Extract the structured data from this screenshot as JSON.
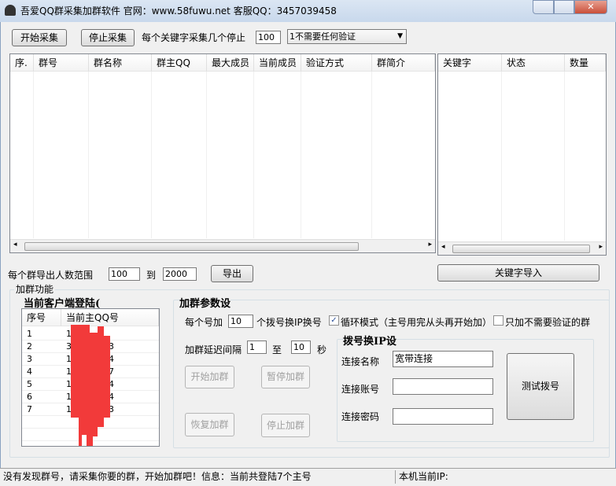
{
  "window": {
    "title": "吾爱QQ群采集加群软件  官网：www.58fuwu.net 客服QQ：3457039458",
    "close_glyph": "✕"
  },
  "toolbar": {
    "start_collect": "开始采集",
    "stop_collect": "停止采集",
    "per_keyword_label": "每个关键字采集几个停止",
    "per_keyword_value": "100",
    "verify_select": "1不需要任何验证",
    "dropdown_glyph": "▼"
  },
  "group_table": {
    "columns": [
      "序.",
      "群号",
      "群名称",
      "群主QQ",
      "最大成员",
      "当前成员",
      "验证方式",
      "群简介"
    ]
  },
  "keyword_table": {
    "columns": [
      "关键字",
      "状态",
      "数量"
    ]
  },
  "scroll": {
    "left": "◂",
    "right": "▸"
  },
  "export": {
    "label": "每个群导出人数范围",
    "min": "100",
    "to": "到",
    "max": "2000",
    "export_button": "导出",
    "keyword_import": "关键字导入"
  },
  "add_group": {
    "title": "加群功能",
    "clients_title": "当前客户端登陆(",
    "clients_columns": [
      "序号",
      "当前主QQ号"
    ],
    "clients": [
      {
        "no": "1",
        "qq_start": "1",
        "qq_end": ""
      },
      {
        "no": "2",
        "qq_start": "3",
        "qq_end": "3"
      },
      {
        "no": "3",
        "qq_start": "1",
        "qq_end": "4"
      },
      {
        "no": "4",
        "qq_start": "1",
        "qq_end": "7"
      },
      {
        "no": "5",
        "qq_start": "1",
        "qq_end": "4"
      },
      {
        "no": "6",
        "qq_start": "1",
        "qq_end": "4"
      },
      {
        "no": "7",
        "qq_start": "1",
        "qq_end": "3"
      }
    ],
    "params_title": "加群参数设",
    "per_account_label": "每个号加",
    "per_account_value": "10",
    "per_account_suffix": "个拨号换IP换号",
    "loop_mode_label": "循环模式（主号用完从头再开始加）",
    "loop_mode_checked": true,
    "no_verify_only_label": "只加不需要验证的群",
    "no_verify_only_checked": false,
    "delay_label": "加群延迟间隔",
    "delay_min": "1",
    "delay_to": "至",
    "delay_max": "10",
    "delay_unit": "秒",
    "start": "开始加群",
    "pause": "暂停加群",
    "resume": "恢复加群",
    "stop": "停止加群"
  },
  "dial": {
    "title": "拨号换IP设",
    "name_label": "连接名称",
    "name_value": "宽带连接",
    "account_label": "连接账号",
    "account_value": "",
    "password_label": "连接密码",
    "password_value": "",
    "test_button": "测试拨号"
  },
  "status": {
    "message": "没有发现群号，请采集你要的群，开始加群吧！信息：当前共登陆7个主号",
    "ip_label": "本机当前IP:"
  }
}
